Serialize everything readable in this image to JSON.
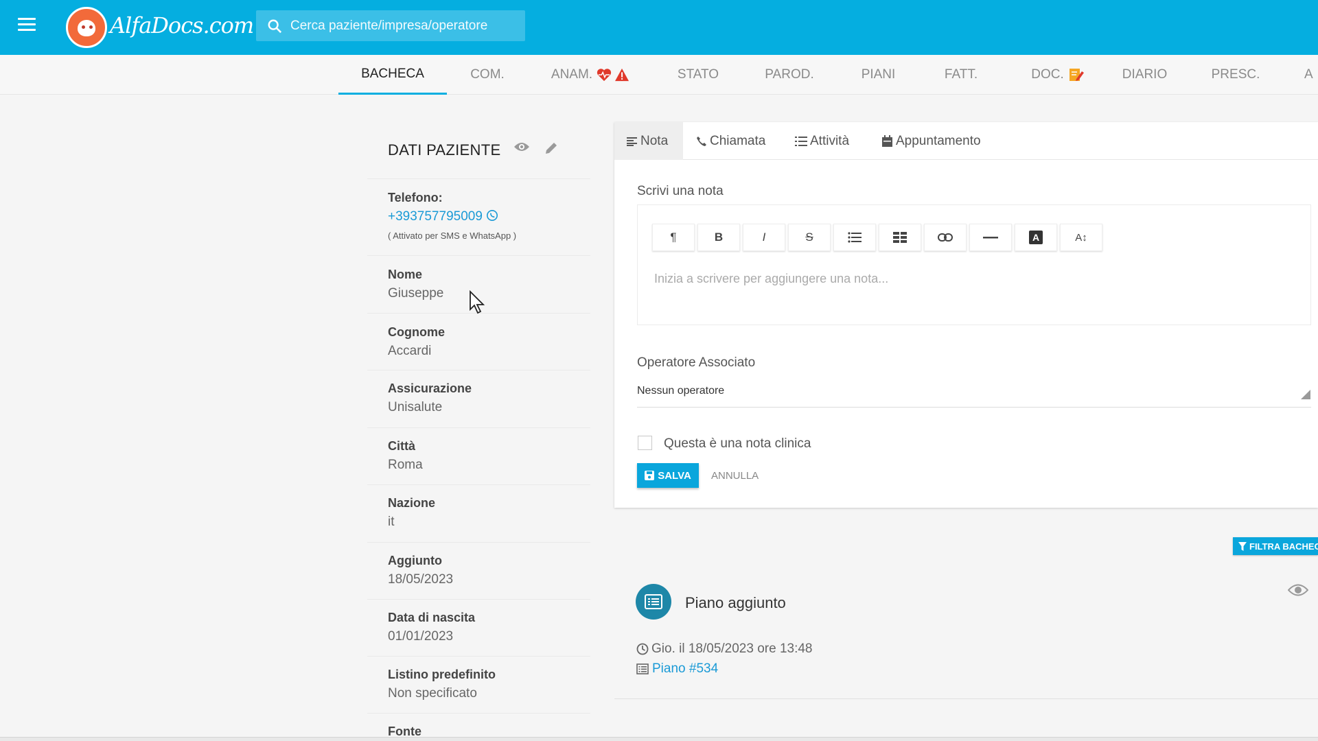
{
  "header": {
    "logo_text": "AlfaDocs.com",
    "search_placeholder": "Cerca paziente/impresa/operatore",
    "brand_color": "#05aee0"
  },
  "tabs": [
    {
      "label": "BACHECA",
      "active": true
    },
    {
      "label": "COM."
    },
    {
      "label": "ANAM.",
      "icons": [
        "heartbeat-icon",
        "warning-icon"
      ]
    },
    {
      "label": "STATO"
    },
    {
      "label": "PAROD."
    },
    {
      "label": "PIANI"
    },
    {
      "label": "FATT."
    },
    {
      "label": "DOC.",
      "icons": [
        "edit-doc-icon"
      ]
    },
    {
      "label": "DIARIO"
    },
    {
      "label": "PRESC."
    },
    {
      "label": "A"
    }
  ],
  "patient": {
    "title": "DATI PAZIENTE",
    "phone_label": "Telefono:",
    "phone": "+393757795009",
    "phone_note": "( Attivato per SMS e WhatsApp )",
    "fields": [
      {
        "label": "Nome",
        "value": "Giuseppe"
      },
      {
        "label": "Cognome",
        "value": "Accardi"
      },
      {
        "label": "Assicurazione",
        "value": "Unisalute"
      },
      {
        "label": "Città",
        "value": "Roma"
      },
      {
        "label": "Nazione",
        "value": "it"
      },
      {
        "label": "Aggiunto",
        "value": "18/05/2023"
      },
      {
        "label": "Data di nascita",
        "value": "01/01/2023"
      },
      {
        "label": "Listino predefinito",
        "value": "Non specificato"
      },
      {
        "label": "Fonte",
        "value": ""
      }
    ]
  },
  "note_card": {
    "subtabs": [
      {
        "label": "Nota",
        "icon": "align-left-icon",
        "active": true
      },
      {
        "label": "Chiamata",
        "icon": "phone-icon"
      },
      {
        "label": "Attività",
        "icon": "list-icon"
      },
      {
        "label": "Appuntamento",
        "icon": "calendar-icon"
      }
    ],
    "write_label": "Scrivi una nota",
    "toolbar": [
      "¶",
      "B",
      "I",
      "S",
      "bullet-list",
      "table",
      "link",
      "hr",
      "A",
      "A↕"
    ],
    "editor_placeholder": "Inizia a scrivere per aggiungere una nota...",
    "operator_label": "Operatore Associato",
    "operator_value": "Nessun operatore",
    "clinical_label": "Questa è una nota clinica",
    "save_label": "SALVA",
    "cancel_label": "ANNULLA"
  },
  "filter_label": "FILTRA BACHECA",
  "timeline": {
    "title": "Piano aggiunto",
    "date": "Gio. il 18/05/2023 ore 13:48",
    "link": "Piano #534"
  }
}
